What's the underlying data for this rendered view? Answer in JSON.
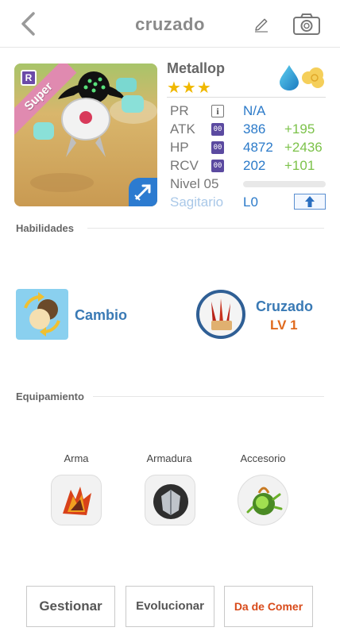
{
  "header": {
    "title": "cruzado",
    "back_icon": "chevron-left-icon",
    "edit_icon": "pencil-icon",
    "camera_icon": "camera-icon"
  },
  "monster": {
    "name": "Metallop",
    "stars": "★★★",
    "star_count": 3,
    "rarity_badge": "R",
    "ribbon": "Super",
    "elements": [
      "water-drop-icon",
      "cloud-icon"
    ]
  },
  "stats": {
    "pr": {
      "label": "PR",
      "value": "N/A"
    },
    "atk": {
      "label": "ATK",
      "value": "386",
      "bonus": "+195"
    },
    "hp": {
      "label": "HP",
      "value": "4872",
      "bonus": "+2436"
    },
    "rcv": {
      "label": "RCV",
      "value": "202",
      "bonus": "+101"
    },
    "level": {
      "label": "Nivel 05",
      "progress": 0
    },
    "zodiac": {
      "label": "Sagitario",
      "value": "L0"
    },
    "badge_text": "00",
    "info_text": "i"
  },
  "skills": {
    "heading": "Habilidades",
    "active": {
      "name": "Cambio",
      "icon": "swap-icon"
    },
    "leader": {
      "name": "Cruzado",
      "level": "LV 1",
      "icon": "claw-icon"
    }
  },
  "equipment": {
    "heading": "Equipamiento",
    "slots": [
      {
        "label": "Arma",
        "icon": "weapon-icon"
      },
      {
        "label": "Armadura",
        "icon": "armor-icon"
      },
      {
        "label": "Accesorio",
        "icon": "accessory-icon"
      }
    ]
  },
  "actions": {
    "manage": "Gestionar",
    "evolve": "Evolucionar",
    "feed": "Da de Comer"
  },
  "colors": {
    "accent_blue": "#2b7ac9",
    "bonus_green": "#7cc24a",
    "level_orange": "#e06a1e",
    "star_gold": "#f0b800",
    "feed_red": "#d84a1a"
  }
}
